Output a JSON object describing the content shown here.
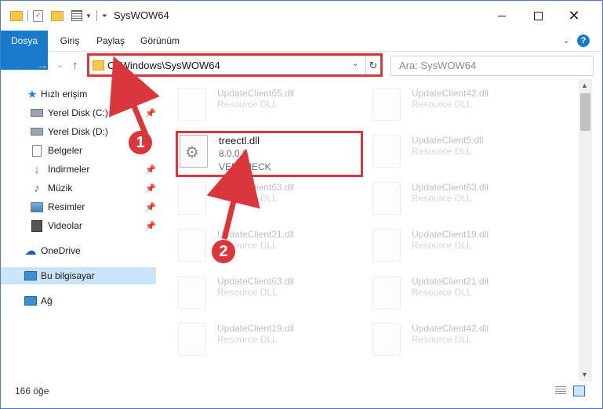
{
  "window": {
    "title": "SysWOW64"
  },
  "ribbon": {
    "tabs": [
      "Dosya",
      "Giriş",
      "Paylaş",
      "Görünüm"
    ]
  },
  "address": {
    "path": "C:\\Windows\\SysWOW64"
  },
  "search": {
    "placeholder": "Ara: SysWOW64"
  },
  "sidebar": {
    "items": [
      {
        "label": "Hızlı erişim",
        "icon": "star-icon"
      },
      {
        "label": "Yerel Disk (C:)",
        "icon": "drive-icon",
        "pinned": true
      },
      {
        "label": "Yerel Disk (D:)",
        "icon": "drive-icon"
      },
      {
        "label": "Belgeler",
        "icon": "documents-icon"
      },
      {
        "label": "İndirmeler",
        "icon": "download-icon",
        "pinned": true
      },
      {
        "label": "Müzik",
        "icon": "music-icon",
        "pinned": true
      },
      {
        "label": "Resimler",
        "icon": "pictures-icon",
        "pinned": true
      },
      {
        "label": "Videolar",
        "icon": "videos-icon",
        "pinned": true
      },
      {
        "label": "OneDrive",
        "icon": "cloud-icon"
      },
      {
        "label": "Bu bilgisayar",
        "icon": "computer-icon",
        "selected": true
      },
      {
        "label": "Ağ",
        "icon": "network-icon"
      }
    ]
  },
  "files": {
    "highlighted": {
      "name": "treectl.dll",
      "version": "8.0.0.0",
      "desc": "VERCHECK"
    },
    "left": [
      {
        "name": "UpdateClient65.dll",
        "desc": "Resource DLL"
      },
      {
        "name": "UpdateClient63.dll",
        "desc": "Resource DLL"
      },
      {
        "name": "UpdateClient21.dll",
        "desc": "Resource DLL"
      },
      {
        "name": "UpdateClient63.dll",
        "desc": "Resource DLL"
      },
      {
        "name": "UpdateClient19.dll",
        "desc": "Resource DLL"
      }
    ],
    "right": [
      {
        "name": "UpdateClient42.dll",
        "desc": "Resource DLL"
      },
      {
        "name": "UpdateClient5.dll",
        "desc": "Resource DLL"
      },
      {
        "name": "UpdateClient63.dll",
        "desc": "Resource DLL"
      },
      {
        "name": "UpdateClient19.dll",
        "desc": "Resource DLL"
      },
      {
        "name": "UpdateClient21.dll",
        "desc": "Resource DLL"
      },
      {
        "name": "UpdateClient42.dll",
        "desc": "Resource DLL"
      }
    ]
  },
  "status": {
    "count": "166 öğe"
  },
  "annotations": {
    "badge1": "1",
    "badge2": "2",
    "color": "#d9373b"
  }
}
